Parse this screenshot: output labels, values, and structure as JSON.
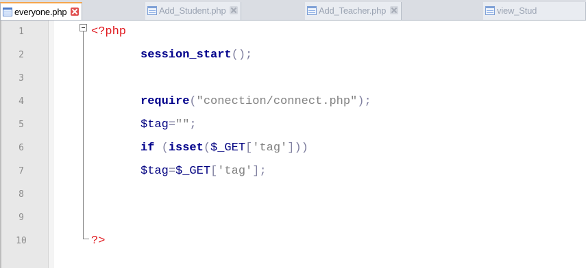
{
  "tabs": [
    {
      "label": "everyone.php",
      "active": true
    },
    {
      "label": "Add_Student.php",
      "active": false
    },
    {
      "label": "Add_Teacher.php",
      "active": false
    },
    {
      "label": "view_Stud",
      "active": false
    }
  ],
  "editor": {
    "line_numbers": [
      "1",
      "2",
      "3",
      "4",
      "5",
      "6",
      "7",
      "8",
      "9",
      "10"
    ],
    "code": {
      "l1_open": "<?php",
      "l2_fn": "session_start",
      "l2_rest": "();",
      "l4_fn": "require",
      "l4_p1": "(",
      "l4_str": "\"conection/connect.php\"",
      "l4_p2": ");",
      "l5_var": "$tag",
      "l5_op": "=",
      "l5_str": "\"\"",
      "l5_end": ";",
      "l6_kw": "if",
      "l6_p1": " (",
      "l6_fn": "isset",
      "l6_p2": "(",
      "l6_var": "$_GET",
      "l6_b1": "[",
      "l6_str": "'tag'",
      "l6_b2": "]))",
      "l7_var": "$tag",
      "l7_op": "=",
      "l7_var2": "$_GET",
      "l7_b1": "[",
      "l7_str": "'tag'",
      "l7_b2": "];",
      "l10_close": "?>"
    }
  },
  "colors": {
    "tab_active_accent": "#f5a54c",
    "keyword": "#00008b",
    "php_tag": "#e0181e",
    "string": "#808080",
    "variable": "#000080"
  }
}
